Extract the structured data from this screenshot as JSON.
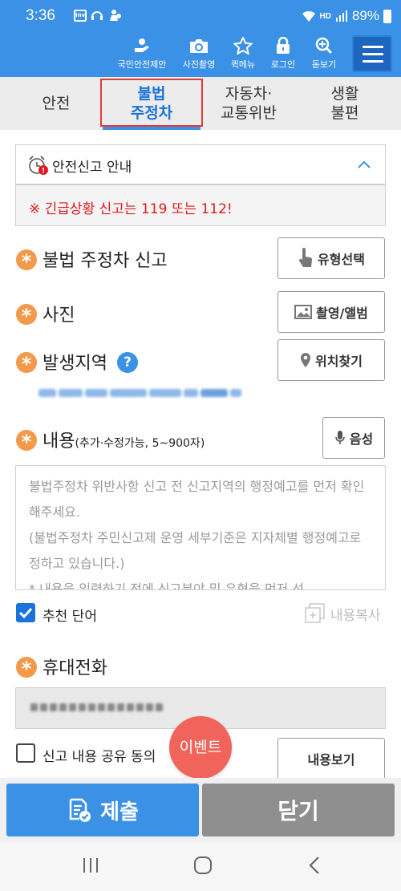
{
  "status_bar": {
    "time": "3:36",
    "battery": "89%",
    "hd_label": "HD"
  },
  "toolbar": {
    "items": [
      {
        "label": "국민안전제안",
        "icon": "hand-heart-icon"
      },
      {
        "label": "사진촬영",
        "icon": "camera-icon"
      },
      {
        "label": "퀵메뉴",
        "icon": "star-icon"
      },
      {
        "label": "로그인",
        "icon": "lock-icon"
      },
      {
        "label": "돋보기",
        "icon": "magnifier-plus-icon"
      }
    ],
    "menu_icon": "hamburger-icon"
  },
  "tabs": [
    {
      "label": "안전",
      "active": false
    },
    {
      "label": "불법\n주정차",
      "active": true
    },
    {
      "label": "자동차·\n교통위반",
      "active": false
    },
    {
      "label": "생활\n불편",
      "active": false
    }
  ],
  "info": {
    "label": "안전신고 안내",
    "icon": "alarm-clock-icon",
    "toggle_icon": "chevron-up-icon"
  },
  "warning": {
    "text": "※ 긴급상황 신고는 119 또는 112!"
  },
  "sections": {
    "report": {
      "title": "불법 주정차 신고",
      "button": "유형선택",
      "button_icon": "hand-pointer-icon"
    },
    "photo": {
      "title": "사진",
      "button": "촬영/앨범",
      "button_icon": "image-icon"
    },
    "location": {
      "title": "발생지역",
      "help": "?",
      "button": "위치찾기",
      "button_icon": "map-pin-icon"
    },
    "content": {
      "title": "내용",
      "subtitle": "(추가·수정가능, 5~900자)",
      "button": "음성",
      "button_icon": "microphone-icon"
    },
    "phone": {
      "title": "휴대전화"
    }
  },
  "content_placeholder": "불법주정차 위반사항 신고 전 신고지역의 행정예고를 먼저 확인해주세요.\n(불법주정차 주민신고제 운영 세부기준은 지자체별 행정예고로 정하고 있습니다.)\n* 내용을 입력하기 전에 신고분야 및 유형을 먼저 선",
  "recommend": {
    "label": "추천 단어",
    "checked": true
  },
  "copy": {
    "label": "내용복사"
  },
  "share": {
    "label": "신고 내용 공유 동의",
    "checked": false,
    "button": "내용보기"
  },
  "event": {
    "label": "이벤트"
  },
  "actions": {
    "submit": "제출",
    "close": "닫기"
  },
  "colors": {
    "primary": "#3b91e6",
    "accent_orange": "#f39a4a",
    "warning_red": "#e0191e",
    "event": "#f0645b",
    "tab_highlight": "#e53a3a"
  }
}
